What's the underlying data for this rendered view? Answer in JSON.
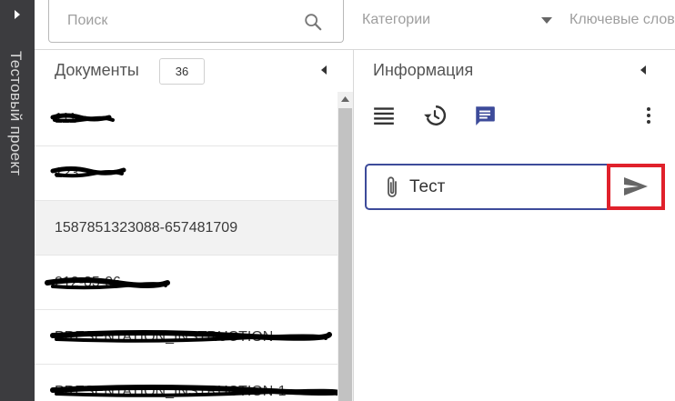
{
  "project": {
    "title": "Тестовый проект"
  },
  "toolbar": {
    "search_placeholder": "Поиск",
    "search_value": "",
    "categories_label": "Категории",
    "keywords_label": "Ключевые слова"
  },
  "documents": {
    "title": "Документы",
    "count": "36",
    "items": [
      {
        "name": "111",
        "redacted": true,
        "selected": false
      },
      {
        "name": "123",
        "redacted": true,
        "selected": false
      },
      {
        "name": "1587851323088-657481709",
        "redacted": false,
        "selected": true
      },
      {
        "name": "212-85-06",
        "redacted": true,
        "selected": false
      },
      {
        "name": "PRESENTATION_INSTRUCTION",
        "redacted": true,
        "selected": false
      },
      {
        "name": "PRESENTATION_INSTRUCTION-1",
        "redacted": true,
        "selected": false
      }
    ]
  },
  "info": {
    "title": "Информация",
    "tabs": [
      {
        "icon": "list-icon",
        "active": false
      },
      {
        "icon": "history-icon",
        "active": false
      },
      {
        "icon": "comment-icon",
        "active": true
      }
    ],
    "comment": {
      "value": "Тест",
      "placeholder": ""
    }
  },
  "colors": {
    "accent": "#3d4b9a",
    "highlight": "#e0212b",
    "sidebar": "#3c3c3f",
    "muted": "#9e9e9e"
  }
}
